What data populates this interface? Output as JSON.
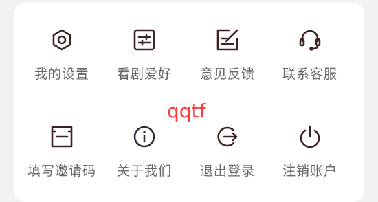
{
  "menu": {
    "row1": [
      {
        "label": "我的设置",
        "icon": "gear-icon"
      },
      {
        "label": "看剧爱好",
        "icon": "sliders-icon"
      },
      {
        "label": "意见反馈",
        "icon": "edit-note-icon"
      },
      {
        "label": "联系客服",
        "icon": "headset-icon"
      }
    ],
    "row2": [
      {
        "label": "填写邀请码",
        "icon": "invite-code-icon"
      },
      {
        "label": "关于我们",
        "icon": "info-icon"
      },
      {
        "label": "退出登录",
        "icon": "logout-icon"
      },
      {
        "label": "注销账户",
        "icon": "power-icon"
      }
    ]
  },
  "watermark": "qqtf",
  "colors": {
    "icon_dark": "#3a2320",
    "icon_info": "#2b2f3a",
    "label": "#666666",
    "watermark": "#ff3b3b",
    "card_bg": "#ffffff",
    "page_bg": "#f2f2f2"
  }
}
